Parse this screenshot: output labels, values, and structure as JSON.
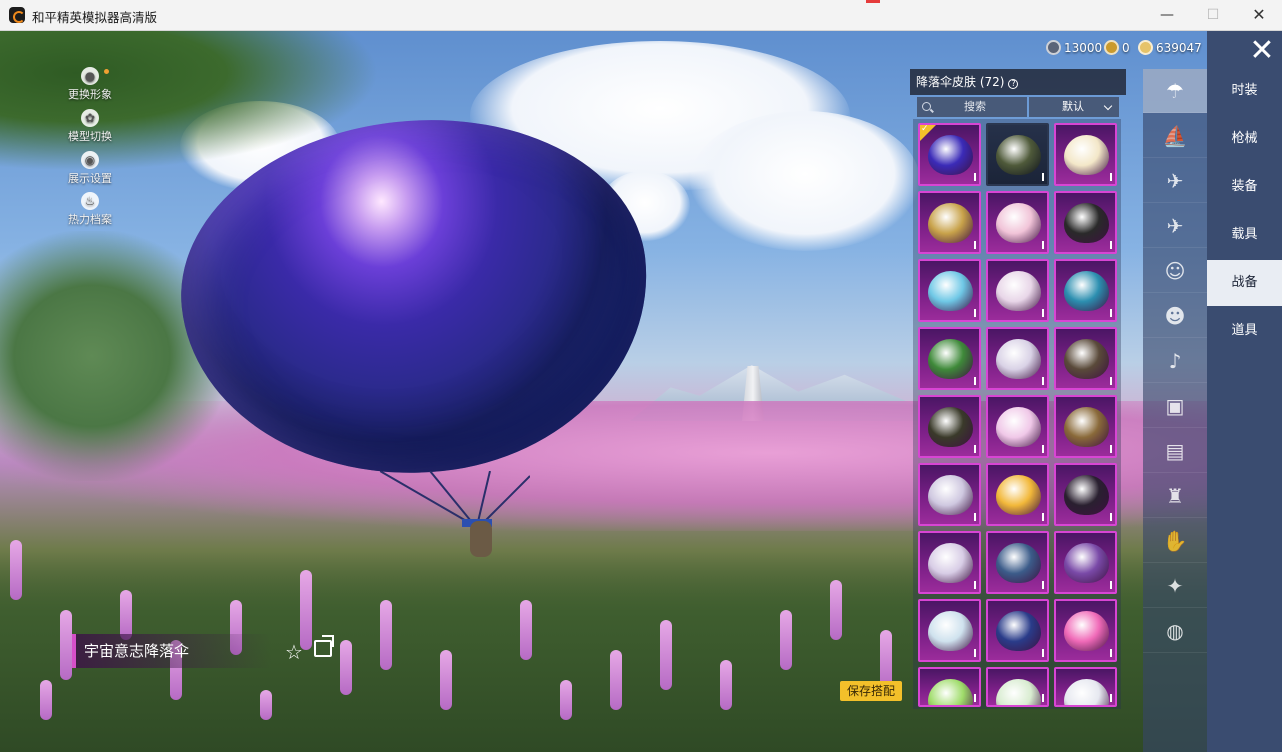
{
  "window": {
    "title": "和平精英模拟器高清版",
    "min_label": "—",
    "max_label": "☐",
    "close_label": "✕"
  },
  "quick_menu": [
    {
      "label": "更换形象",
      "icon": "avatar-icon",
      "glyph": "●"
    },
    {
      "label": "模型切换",
      "icon": "gear-icon",
      "glyph": "✿"
    },
    {
      "label": "展示设置",
      "icon": "eye-icon",
      "glyph": "◉"
    },
    {
      "label": "热力档案",
      "icon": "flame-icon",
      "glyph": "♨"
    }
  ],
  "currency": [
    {
      "value": "13000",
      "icon": "silver-coin-icon"
    },
    {
      "value": "0",
      "icon": "gold-badge-icon"
    },
    {
      "value": "639047",
      "icon": "gold-coin-icon"
    }
  ],
  "panel": {
    "title": "降落伞皮肤 (72)",
    "help": "?",
    "search_label": "搜索",
    "sort_label": "默认"
  },
  "item": {
    "name": "宇宙意志降落伞",
    "favorite_glyph": "☆",
    "save_label": "保存搭配"
  },
  "tabs": [
    {
      "label": "时装",
      "active": false
    },
    {
      "label": "枪械",
      "active": false
    },
    {
      "label": "装备",
      "active": false
    },
    {
      "label": "载具",
      "active": false
    },
    {
      "label": "战备",
      "active": true
    },
    {
      "label": "道具",
      "active": false
    }
  ],
  "category_icons": [
    {
      "name": "parachute-icon",
      "glyph": "☂",
      "active": true
    },
    {
      "name": "boat-icon",
      "glyph": "⛵",
      "active": false
    },
    {
      "name": "drone-icon",
      "glyph": "✈",
      "active": false
    },
    {
      "name": "plane-icon",
      "glyph": "✈",
      "active": false
    },
    {
      "name": "emote-icon",
      "glyph": "☺",
      "active": false
    },
    {
      "name": "robot-icon",
      "glyph": "☻",
      "active": false
    },
    {
      "name": "speaker-icon",
      "glyph": "♪",
      "active": false
    },
    {
      "name": "companion-icon",
      "glyph": "▣",
      "active": false
    },
    {
      "name": "photo-icon",
      "glyph": "▤",
      "active": false
    },
    {
      "name": "spray-icon",
      "glyph": "♜",
      "active": false
    },
    {
      "name": "gesture-icon",
      "glyph": "✋",
      "active": false
    },
    {
      "name": "sparkle-icon",
      "glyph": "✦",
      "active": false
    },
    {
      "name": "ufo-icon",
      "glyph": "◍",
      "active": false
    }
  ],
  "colors": {
    "accent_yellow": "#f3c02a",
    "rarity_purple": "#d845d4",
    "tab_bar": "#3a4c70"
  },
  "skins": [
    {
      "color": "#3b2bb8",
      "selected": true,
      "rare": true
    },
    {
      "color": "#4f5a3a",
      "selected": false,
      "rare": false
    },
    {
      "color": "#f3e7c8",
      "selected": false,
      "rare": true
    },
    {
      "color": "#c8a24a",
      "selected": false,
      "rare": true
    },
    {
      "color": "#f1c4d8",
      "selected": false,
      "rare": true
    },
    {
      "color": "#2a2a2a",
      "selected": false,
      "rare": true
    },
    {
      "color": "#6fc8e6",
      "selected": false,
      "rare": true
    },
    {
      "color": "#e8d6e8",
      "selected": false,
      "rare": true
    },
    {
      "color": "#2c8fb0",
      "selected": false,
      "rare": true
    },
    {
      "color": "#3f8a3a",
      "selected": false,
      "rare": true
    },
    {
      "color": "#d9d2e6",
      "selected": false,
      "rare": true
    },
    {
      "color": "#5a4a3a",
      "selected": false,
      "rare": true
    },
    {
      "color": "#3a3a2a",
      "selected": false,
      "rare": true
    },
    {
      "color": "#f0c8e8",
      "selected": false,
      "rare": true
    },
    {
      "color": "#8a6a3a",
      "selected": false,
      "rare": true
    },
    {
      "color": "#cfc8e0",
      "selected": false,
      "rare": true
    },
    {
      "color": "#f2b83a",
      "selected": false,
      "rare": true
    },
    {
      "color": "#2a2030",
      "selected": false,
      "rare": true
    },
    {
      "color": "#d8cde6",
      "selected": false,
      "rare": true
    },
    {
      "color": "#3c5c8a",
      "selected": false,
      "rare": true
    },
    {
      "color": "#7a4aa8",
      "selected": false,
      "rare": true
    },
    {
      "color": "#cfe2ee",
      "selected": false,
      "rare": true
    },
    {
      "color": "#2a3c8a",
      "selected": false,
      "rare": true
    },
    {
      "color": "#f06ab8",
      "selected": false,
      "rare": true
    },
    {
      "color": "#9fdc6a",
      "selected": false,
      "rare": true
    },
    {
      "color": "#d8ecd0",
      "selected": false,
      "rare": true
    },
    {
      "color": "#e6e8f0",
      "selected": false,
      "rare": true
    }
  ]
}
